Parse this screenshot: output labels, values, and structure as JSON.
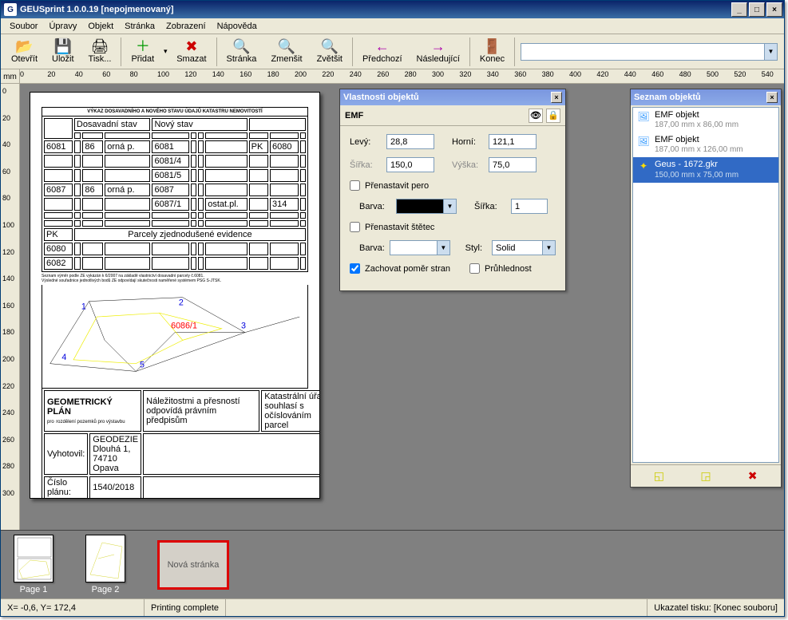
{
  "title": "GEUSprint 1.0.0.19 [nepojmenovaný]",
  "menu": [
    "Soubor",
    "Úpravy",
    "Objekt",
    "Stránka",
    "Zobrazení",
    "Nápověda"
  ],
  "toolbar": {
    "open": "Otevřít",
    "save": "Uložit",
    "print": "Tisk...",
    "add": "Přidat",
    "delete": "Smazat",
    "page": "Stránka",
    "zoomout": "Zmenšit",
    "zoomin": "Zvětšit",
    "prev": "Předchozí",
    "next": "Následující",
    "end": "Konec"
  },
  "ruler_unit": "mm",
  "canvas": {
    "doc_header": "VÝKAZ DOSAVADNÍHO A NOVÉHO STAVU ÚDAJŮ KATASTRU NEMOVITOSTÍ",
    "gp_title": "GEOMETRICKÝ PLÁN",
    "gp_pro": "pro"
  },
  "props": {
    "panel_title": "Vlastnosti objektů",
    "subtitle": "EMF",
    "labels": {
      "left": "Levý:",
      "top": "Horní:",
      "width": "Šířka:",
      "height": "Výška:",
      "override_pen": "Přenastavit pero",
      "override_brush": "Přenastavit štětec",
      "color": "Barva:",
      "linewidth": "Šířka:",
      "style": "Styl:",
      "keep_ratio": "Zachovat poměr stran",
      "transparency": "Průhlednost"
    },
    "values": {
      "left": "28,8",
      "top": "121,1",
      "width": "150,0",
      "height": "75,0",
      "linewidth": "1",
      "style": "Solid"
    },
    "checks": {
      "pen": false,
      "brush": false,
      "ratio": true,
      "trans": false
    }
  },
  "objlist": {
    "panel_title": "Seznam objektů",
    "items": [
      {
        "title": "EMF objekt",
        "sub": "187,00 mm x 86,00 mm",
        "selected": false,
        "icon": "emf"
      },
      {
        "title": "EMF objekt",
        "sub": "187,00 mm x 126,00 mm",
        "selected": false,
        "icon": "emf"
      },
      {
        "title": "Geus - 1672.gkr",
        "sub": "150,00 mm x 75,00 mm",
        "selected": true,
        "icon": "gkr"
      }
    ]
  },
  "thumbs": {
    "page1": "Page 1",
    "page2": "Page 2",
    "newpage": "Nová stránka"
  },
  "status": {
    "coords": "X=  -0,6, Y= 172,4",
    "msg": "Printing complete",
    "pointer": "Ukazatel tisku: [Konec souboru]"
  }
}
